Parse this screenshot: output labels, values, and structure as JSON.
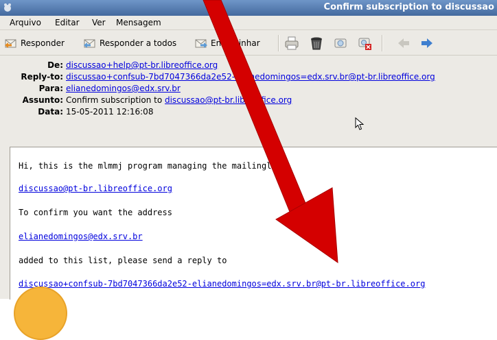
{
  "window": {
    "title": "Confirm subscription to discussao"
  },
  "menu": [
    "Arquivo",
    "Editar",
    "Ver",
    "Mensagem"
  ],
  "toolbar": {
    "reply": "Responder",
    "reply_all": "Responder a todos",
    "forward": "Encaminhar"
  },
  "headers": {
    "from_label": "De:",
    "from_value": "discussao+help@pt-br.libreoffice.org",
    "replyto_label": "Reply-to:",
    "replyto_value": "discussao+confsub-7bd7047366da2e52-elianedomingos=edx.srv.br@pt-br.libreoffice.org",
    "to_label": "Para:",
    "to_value": "elianedomingos@edx.srv.br",
    "subject_label": "Assunto:",
    "subject_text": "Confirm subscription to ",
    "subject_link": "discussao@pt-br.libreoffice.org",
    "date_label": "Data:",
    "date_value": "15-05-2011 12:16:08"
  },
  "body": {
    "line1": "Hi, this is the mlmmj program managing the mailinglist",
    "list_address": "discussao@pt-br.libreoffice.org",
    "line3": "To confirm you want the address",
    "user_address": "elianedomingos@edx.srv.br",
    "line5": "added to this list, please send a reply to",
    "confirm_address": "discussao+confsub-7bd7047366da2e52-elianedomingos=edx.srv.br@pt-br.libreoffice.org"
  },
  "colors": {
    "annotation_arrow": "#d40000",
    "link": "#0000dd",
    "titlebar": "#44699e"
  }
}
